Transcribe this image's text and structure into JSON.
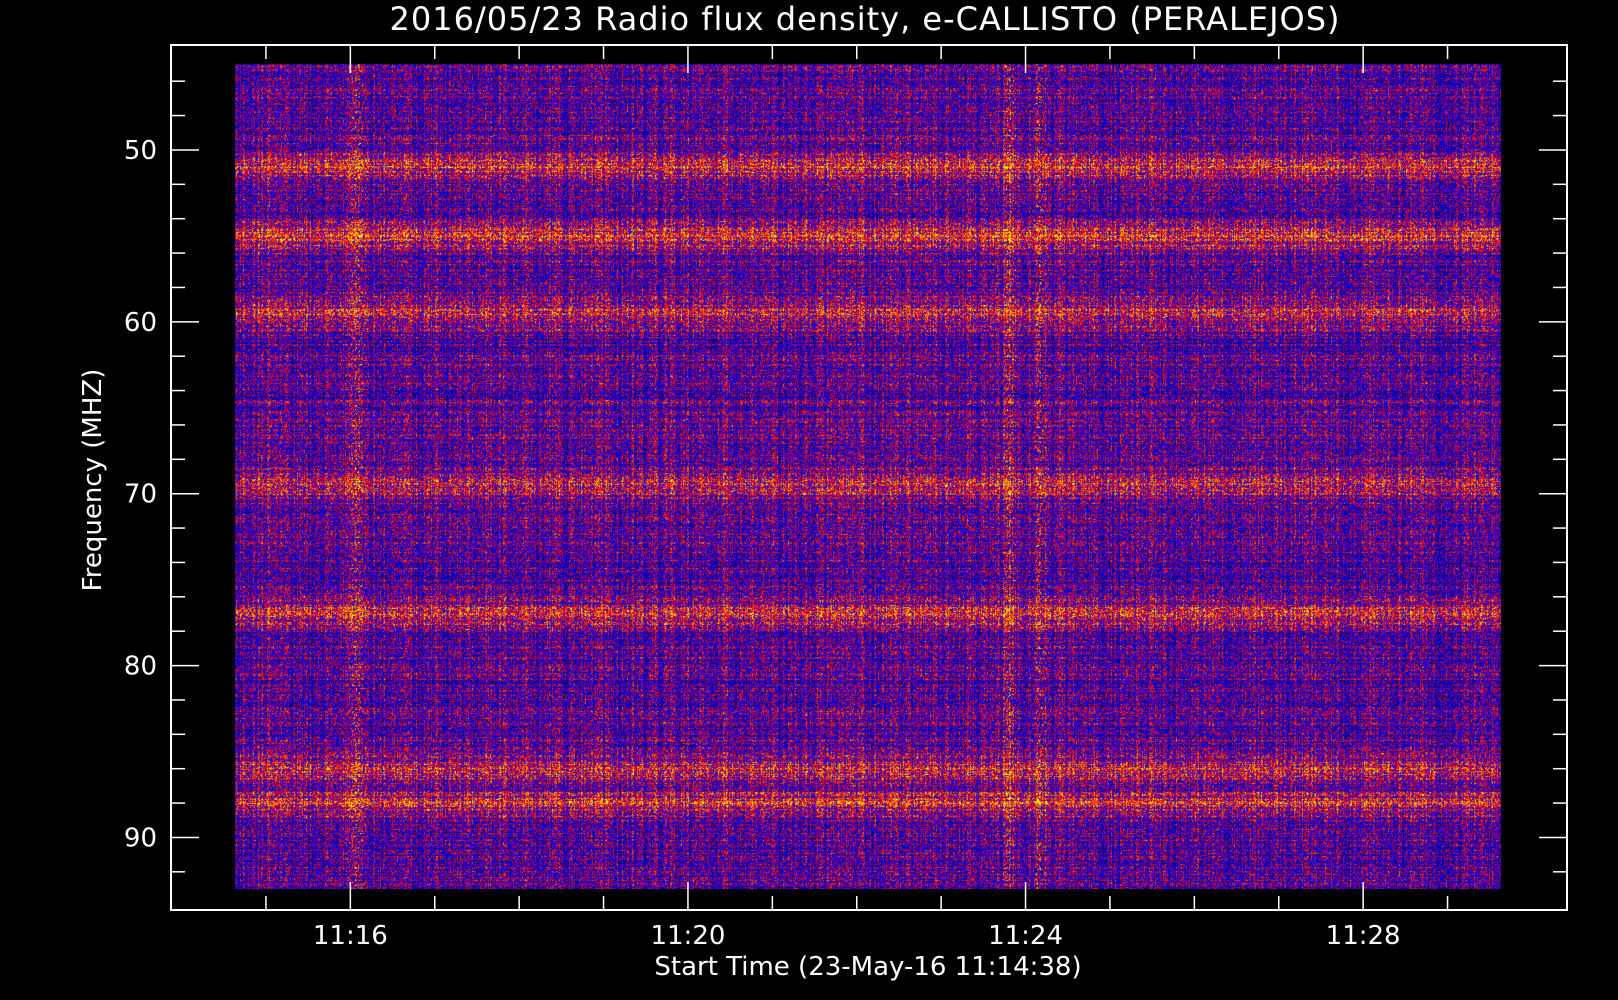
{
  "chart_data": {
    "type": "heatmap",
    "title": "2016/05/23  Radio flux density, e-CALLISTO (PERALEJOS)",
    "xlabel": "Start Time (23-May-16 11:14:38)",
    "ylabel": "Frequency (MHZ)",
    "x_range": [
      "11:14:38",
      "11:29:38"
    ],
    "y_range": [
      45,
      93
    ],
    "y_inverted": true,
    "x_tick_labels": [
      "11:16",
      "11:20",
      "11:24",
      "11:28"
    ],
    "y_tick_labels": [
      "50",
      "60",
      "70",
      "80",
      "90"
    ],
    "colormap": [
      "#000000",
      "#0000ff",
      "#ff0000",
      "#ff8000",
      "#ffff00"
    ],
    "background_color": "#000000",
    "axis_color": "#ffffff",
    "features": {
      "strong_bands_mhz": [
        51,
        55,
        59.5,
        69.5,
        77,
        86,
        88
      ],
      "vertical_burst_times": [
        "11:16:05",
        "11:23:48",
        "11:24:10"
      ]
    }
  }
}
